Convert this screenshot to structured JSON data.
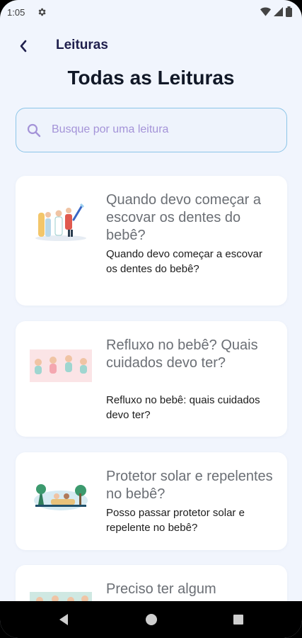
{
  "status_bar": {
    "time": "1:05",
    "icons": [
      "gear-icon",
      "wifi-icon",
      "signal-icon",
      "battery-icon"
    ]
  },
  "header": {
    "back_icon": "chevron-left-icon",
    "title": "Leituras"
  },
  "page_title": "Todas as Leituras",
  "search": {
    "placeholder": "Busque por uma leitura",
    "value": "",
    "icon": "search-icon"
  },
  "articles": [
    {
      "title": "Quando devo começar a escovar os dentes do bebê?",
      "subtitle": "Quando devo começar a escovar os dentes do bebê?",
      "image": "toothbrush-family-illustration"
    },
    {
      "title": "Refluxo no bebê? Quais cuidados devo ter?",
      "subtitle": "Refluxo no bebê: quais cuidados devo ter?",
      "image": "babies-illustration"
    },
    {
      "title": "Protetor solar e repelentes no bebê?",
      "subtitle": "Posso passar protetor solar e repelente no bebê?",
      "image": "beach-family-illustration"
    },
    {
      "title": "Preciso ter algum",
      "subtitle": "",
      "image": "babies-illustration-2"
    }
  ],
  "nav_bar": {
    "back": "nav-back-icon",
    "home": "nav-home-icon",
    "recents": "nav-recents-icon"
  },
  "colors": {
    "background": "#f1f5fd",
    "accent": "#1f1f4d",
    "search_border": "#8cc5e8",
    "placeholder": "#a493d8"
  }
}
